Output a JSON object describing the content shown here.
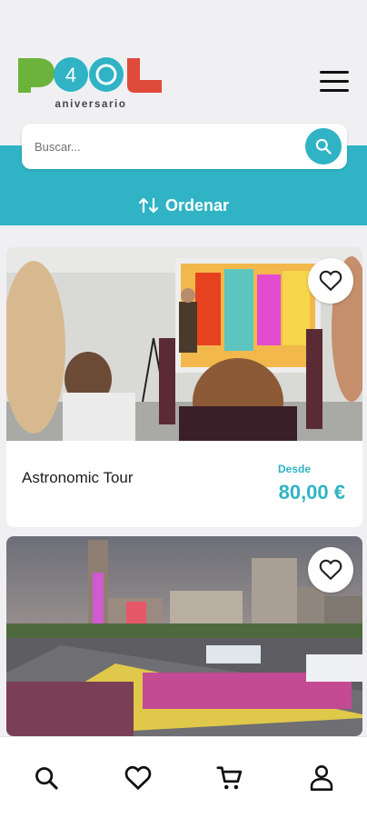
{
  "header": {
    "logo_text": "P40L",
    "logo_subtitle": "aniversario",
    "menu_icon": "hamburger-menu-icon"
  },
  "search": {
    "placeholder": "Buscar...",
    "value": "",
    "button_icon": "search-icon"
  },
  "sort": {
    "label": "Ordenar",
    "icon": "sort-arrows-icon"
  },
  "activities": [
    {
      "title": "Astronomic Tour",
      "price_prefix": "Desde",
      "price": "80,00 €",
      "favorite": false
    },
    {
      "title": "",
      "price_prefix": "",
      "price": "",
      "favorite": false
    }
  ],
  "bottom_nav": [
    {
      "icon": "search-icon"
    },
    {
      "icon": "heart-icon"
    },
    {
      "icon": "cart-icon"
    },
    {
      "icon": "user-icon"
    }
  ],
  "colors": {
    "accent": "#2fb3c5",
    "logo_green": "#6bb33a",
    "logo_red": "#e04a3a",
    "background": "#f0f0f3"
  }
}
